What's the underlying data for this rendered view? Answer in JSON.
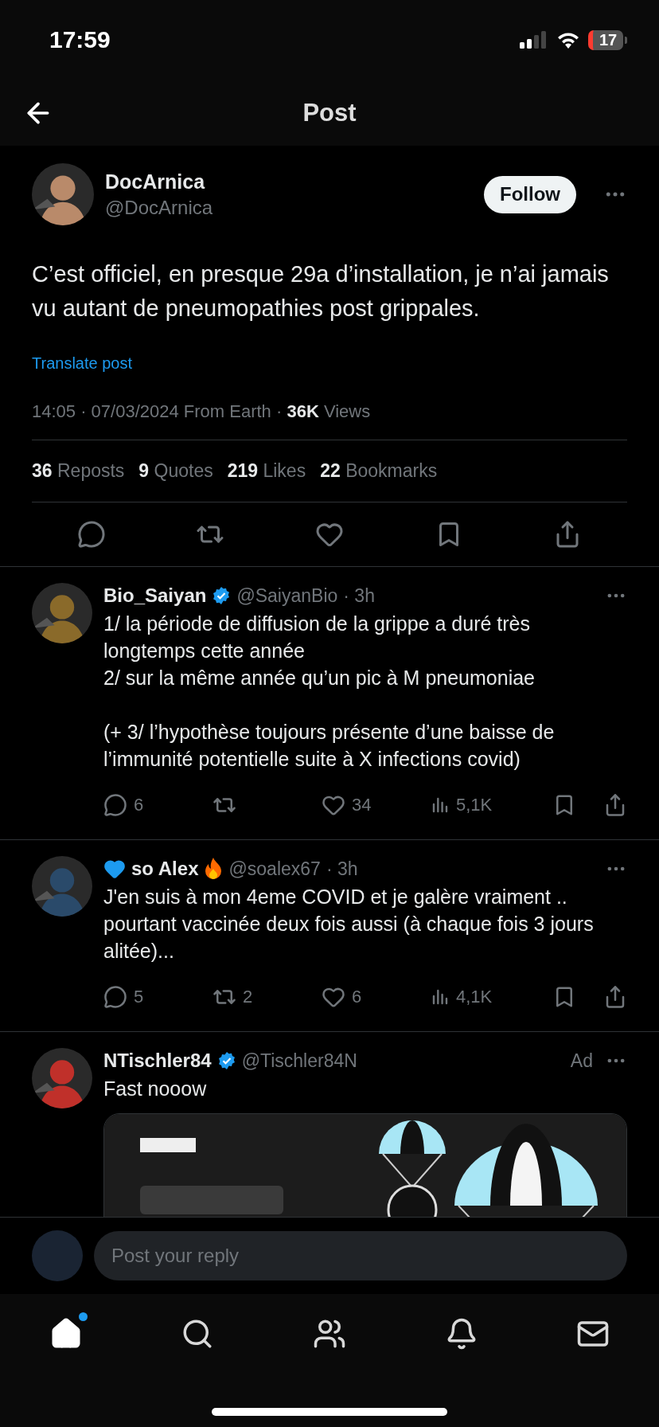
{
  "status_bar": {
    "time": "17:59",
    "battery": "17"
  },
  "header": {
    "title": "Post"
  },
  "post": {
    "author": {
      "name": "DocArnica",
      "handle": "@DocArnica"
    },
    "follow_button": "Follow",
    "text": "C’est officiel, en presque 29a d’installation, je n’ai jamais vu autant de pneumopathies post grippales.",
    "translate": "Translate post",
    "meta": "14:05 · 07/03/2024 From Earth · **36K** Views",
    "stats": [
      {
        "count": "36",
        "label": "Reposts"
      },
      {
        "count": "9",
        "label": "Quotes"
      },
      {
        "count": "219",
        "label": "Likes"
      },
      {
        "count": "22",
        "label": "Bookmarks"
      }
    ]
  },
  "replies": [
    {
      "kind": "reply",
      "name": "Bio_Saiyan",
      "heart_before": false,
      "fire_after": false,
      "verified": true,
      "handle": "@SaiyanBio",
      "time": "· 3h",
      "text": "1/ la période de diffusion de la grippe a duré très longtemps cette année\n2/ sur la même année qu’un pic à M pneumoniae\n\n(+ 3/ l’hypothèse toujours présente d’une baisse de l’immunité potentielle suite à X infections covid)",
      "replies": "6",
      "likes": "34",
      "views": "5,1K"
    },
    {
      "kind": "reply",
      "name": "so Alex",
      "heart_before": true,
      "fire_after": true,
      "verified": false,
      "handle": "@soalex67",
      "time": "· 3h",
      "text": "J'en suis à mon 4eme COVID et je galère vraiment .. pourtant vaccinée deux fois aussi (à chaque fois 3 jours alitée)...",
      "replies": "5",
      "reposts": "2",
      "likes": "6",
      "views": "4,1K"
    },
    {
      "kind": "ad",
      "name": "NTischler84",
      "heart_before": false,
      "fire_after": false,
      "verified": true,
      "handle": "@Tischler84N",
      "ad_label": "Ad",
      "text": "Fast nooow"
    }
  ],
  "reply_bar": {
    "placeholder": "Post your reply"
  },
  "tab_bar": [
    {
      "kind": "home",
      "selected": true,
      "dot": true
    },
    {
      "kind": "search",
      "selected": false,
      "dot": false
    },
    {
      "kind": "people",
      "selected": false,
      "dot": false
    },
    {
      "kind": "bell",
      "selected": false,
      "dot": false
    },
    {
      "kind": "mail",
      "selected": false,
      "dot": false
    }
  ]
}
